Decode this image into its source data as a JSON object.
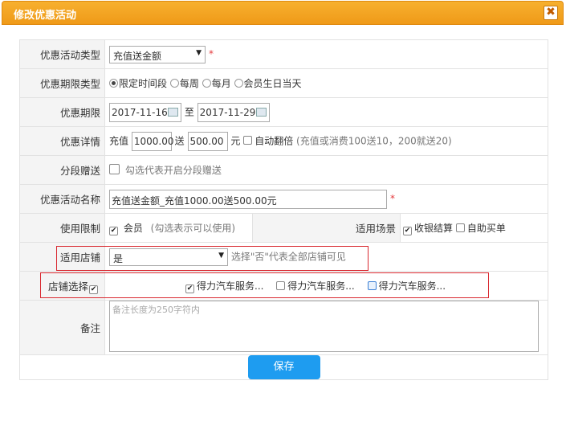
{
  "dialog": {
    "title": "修改优惠活动",
    "close_glyph": "✖"
  },
  "form": {
    "promo_type": {
      "label": "优惠活动类型",
      "value": "充值送金额",
      "required": "*"
    },
    "period_type": {
      "label": "优惠期限类型",
      "options": [
        "限定时间段",
        "每周",
        "每月",
        "会员生日当天"
      ],
      "selected": "限定时间段"
    },
    "period": {
      "label": "优惠期限",
      "start": "2017-11-16",
      "to": "至",
      "end": "2017-11-29"
    },
    "detail": {
      "label": "优惠详情",
      "prefix": "充值",
      "amount": "1000.00",
      "mid": "送",
      "bonus": "500.00",
      "unit": "元",
      "double_label": "自动翻倍",
      "hint": "(充值或消费100送10，200就送20)"
    },
    "segment": {
      "label": "分段赠送",
      "text": "勾选代表开启分段赠送"
    },
    "name": {
      "label": "优惠活动名称",
      "value": "充值送金额_充值1000.00送500.00元",
      "required": "*"
    },
    "limit": {
      "label": "使用限制",
      "member_label": "会员",
      "member_hint": "(勾选表示可以使用)",
      "scene_label": "适用场景",
      "scene_options": [
        {
          "label": "收银结算",
          "checked": "✔"
        },
        {
          "label": "自助买单",
          "checked": ""
        }
      ]
    },
    "stores": {
      "label": "适用店铺",
      "value": "是",
      "hint": "选择\"否\"代表全部店铺可见"
    },
    "store_select": {
      "label": "店铺选择",
      "items": [
        {
          "label": "得力汽车服务...",
          "checked": "✔"
        },
        {
          "label": "得力汽车服务...",
          "checked": ""
        },
        {
          "label": "得力汽车服务...",
          "checked": ""
        }
      ]
    },
    "note": {
      "label": "备注",
      "placeholder": "备注长度为250字符内"
    },
    "save_label": "保存"
  },
  "colors": {
    "title_bar": "#f0a020",
    "save_button": "#1e9cf0",
    "highlight_box": "#d9282f",
    "required": "#e4393c"
  }
}
